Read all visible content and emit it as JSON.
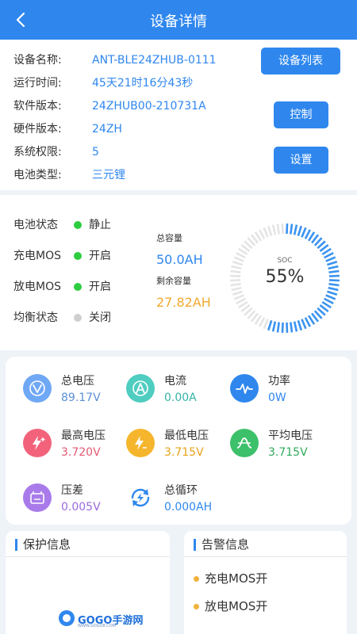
{
  "header": {
    "title": "设备详情"
  },
  "device_info": {
    "rows": [
      {
        "label": "设备名称:",
        "value": "ANT-BLE24ZHUB-0111"
      },
      {
        "label": "运行时间:",
        "value": "45天21时16分43秒"
      },
      {
        "label": "软件版本:",
        "value": "24ZHUB00-210731A"
      },
      {
        "label": "硬件版本:",
        "value": "24ZH"
      },
      {
        "label": "系统权限:",
        "value": "5"
      },
      {
        "label": "电池类型:",
        "value": "三元锂"
      }
    ],
    "buttons": {
      "device_list": "设备列表",
      "control": "控制",
      "settings": "设置"
    }
  },
  "status": {
    "rows": [
      {
        "label": "电池状态",
        "value": "静止",
        "dot_color": "#2ecc40"
      },
      {
        "label": "充电MOS",
        "value": "开启",
        "dot_color": "#2ecc40"
      },
      {
        "label": "放电MOS",
        "value": "开启",
        "dot_color": "#2ecc40"
      },
      {
        "label": "均衡状态",
        "value": "关闭",
        "dot_color": "#cfcfcf"
      }
    ],
    "total_capacity_label": "总容量",
    "total_capacity_value": "50.0AH",
    "remaining_capacity_label": "剩余容量",
    "remaining_capacity_value": "27.82AH",
    "soc_label": "SOC",
    "soc_text": "55%",
    "soc_fraction": 0.55
  },
  "metrics": [
    {
      "name": "总电压",
      "value": "89.17V",
      "icon": "voltage-icon",
      "color": "#6fa8f5",
      "value_color": "#5b8fd6"
    },
    {
      "name": "电流",
      "value": "0.00A",
      "icon": "current-icon",
      "color": "#4ecdc0",
      "value_color": "#36b3a6"
    },
    {
      "name": "功率",
      "value": "0W",
      "icon": "power-icon",
      "color": "#2f87ee",
      "value_color": "#2f87ee"
    },
    {
      "name": "最高电压",
      "value": "3.720V",
      "icon": "max-voltage-icon",
      "color": "#f2637b",
      "value_color": "#e65a73"
    },
    {
      "name": "最低电压",
      "value": "3.715V",
      "icon": "min-voltage-icon",
      "color": "#f5b52c",
      "value_color": "#e6a218"
    },
    {
      "name": "平均电压",
      "value": "3.715V",
      "icon": "avg-voltage-icon",
      "color": "#3cc06a",
      "value_color": "#2faa5a"
    },
    {
      "name": "压差",
      "value": "0.005V",
      "icon": "voltage-diff-icon",
      "color": "#a97bea",
      "value_color": "#9b6ae0"
    },
    {
      "name": "总循环",
      "value": "0.000AH",
      "icon": "cycle-icon",
      "color": "#2f87ee",
      "value_color": "#2f87ee"
    }
  ],
  "protection": {
    "title": "保护信息"
  },
  "alarm": {
    "title": "告警信息",
    "items": [
      "充电MOS开",
      "放电MOS开"
    ]
  },
  "watermark": {
    "text": "GOGO手游网",
    "sub": "WWW.GOGO8.COM"
  }
}
